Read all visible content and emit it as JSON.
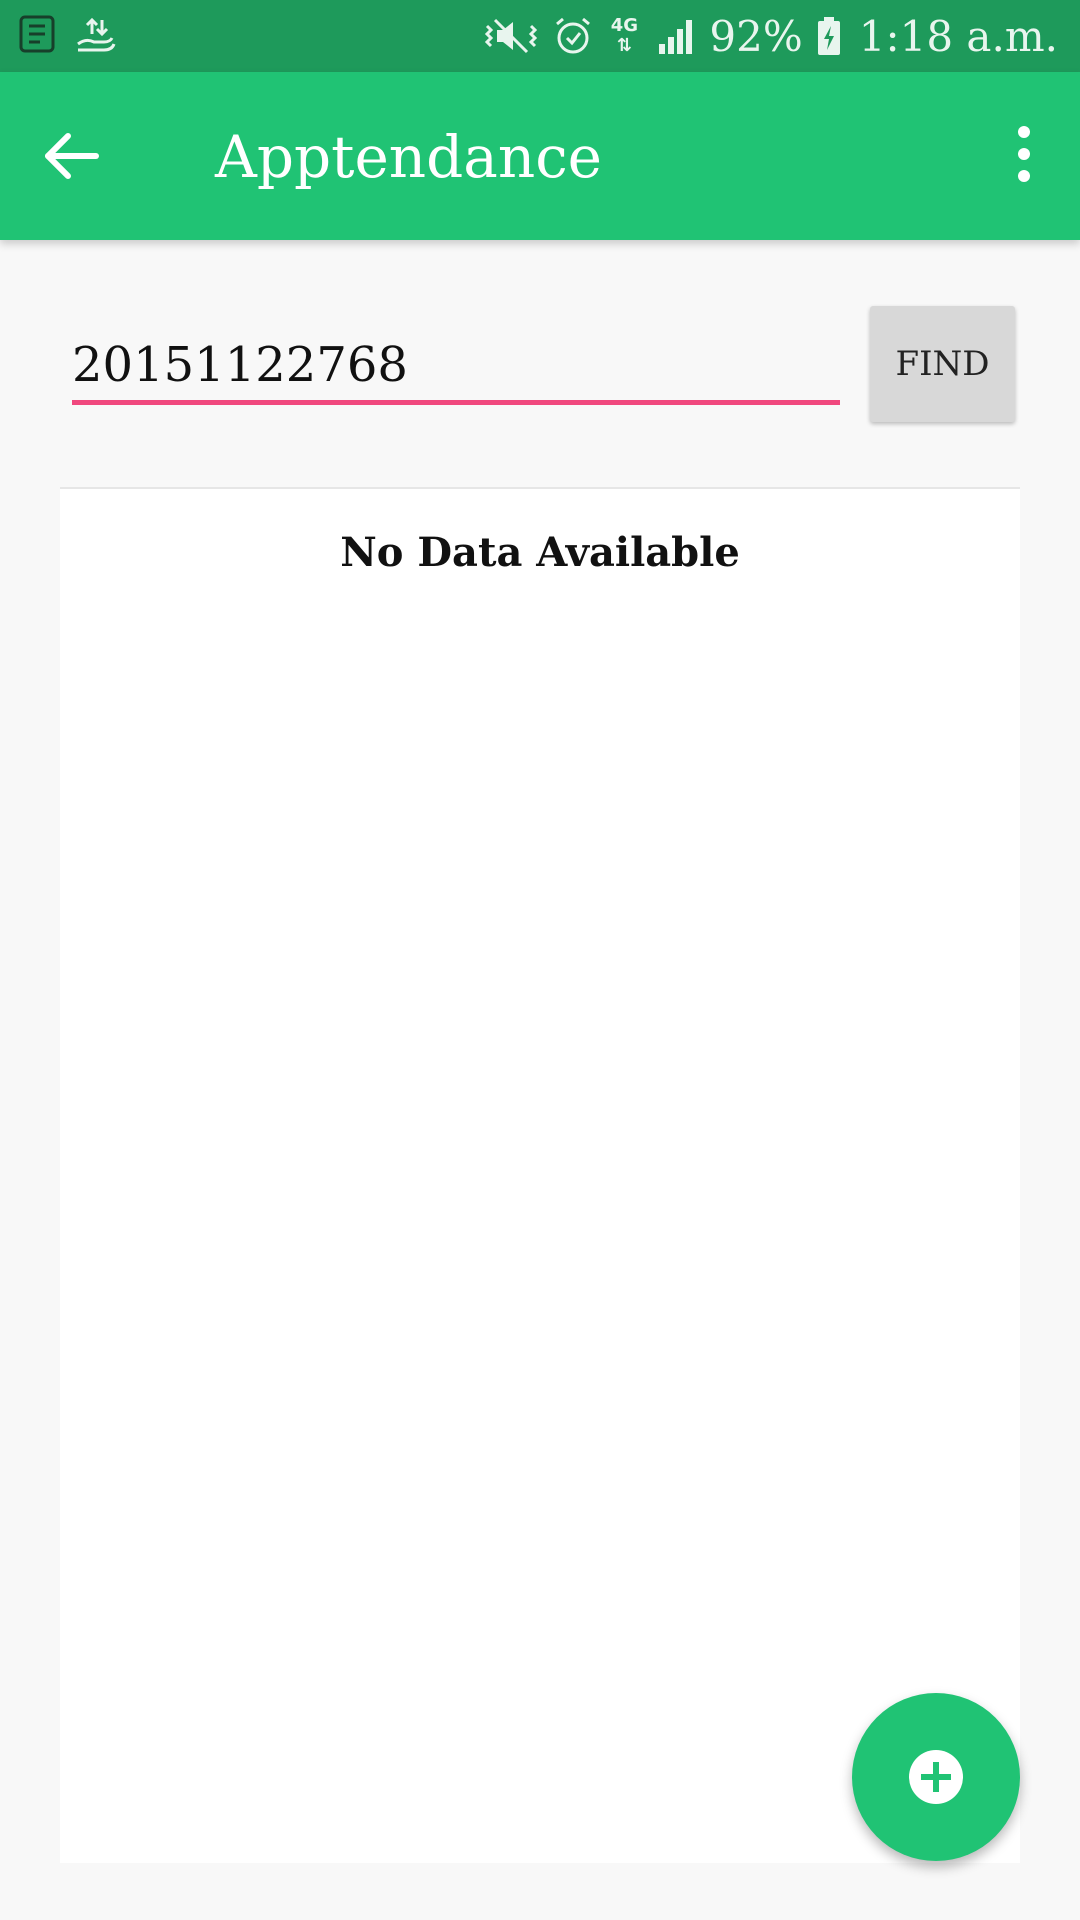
{
  "status_bar": {
    "battery_percent": "92%",
    "time": "1:18 a.m.",
    "network": "4G",
    "icons": [
      "notes-icon",
      "upload-hand-icon",
      "vibrate-mute-icon",
      "alarm-icon",
      "network-4g-icon",
      "signal-icon",
      "battery-charging-icon"
    ]
  },
  "app_bar": {
    "title": "Apptendance",
    "background_color": "#20c374",
    "back_icon": "arrow-back-icon",
    "menu_icon": "more-vert-icon"
  },
  "search": {
    "value": "20151122768",
    "underline_color": "#f0487e",
    "find_label": "FIND"
  },
  "content": {
    "empty_message": "No Data Available"
  },
  "fab": {
    "icon": "add-circle-icon",
    "color": "#20c374"
  }
}
